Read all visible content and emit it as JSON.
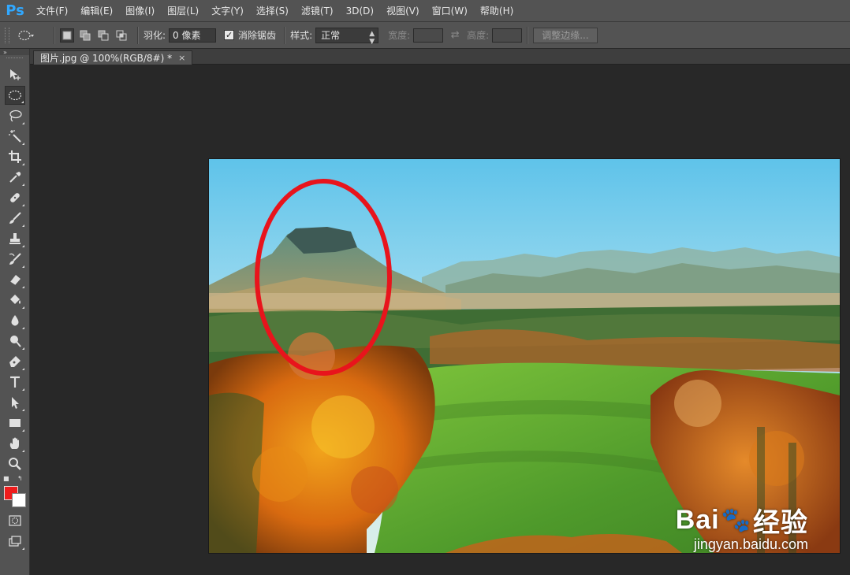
{
  "app": {
    "logo": "Ps"
  },
  "menu": [
    "文件(F)",
    "编辑(E)",
    "图像(I)",
    "图层(L)",
    "文字(Y)",
    "选择(S)",
    "滤镜(T)",
    "3D(D)",
    "视图(V)",
    "窗口(W)",
    "帮助(H)"
  ],
  "options": {
    "feather_label": "羽化:",
    "feather_value": "0 像素",
    "antialias_label": "消除锯齿",
    "antialias_checked": "✓",
    "style_label": "样式:",
    "style_value": "正常",
    "width_label": "宽度:",
    "height_label": "高度:",
    "refine_edge_label": "调整边缘..."
  },
  "document": {
    "tab_title": "图片.jpg @ 100%(RGB/8#) *",
    "close_glyph": "×"
  },
  "watermark": {
    "brand_left": "Bai",
    "brand_right": "经验",
    "paw": "🐾",
    "url": "jingyan.baidu.com"
  },
  "colors": {
    "foreground": "#ef1c1c",
    "background": "#ffffff",
    "annotation": "#e8141c"
  },
  "tools": [
    "move-tool",
    "elliptical-marquee-tool",
    "lasso-tool",
    "magic-wand-tool",
    "crop-tool",
    "eyedropper-tool",
    "healing-brush-tool",
    "brush-tool",
    "clone-stamp-tool",
    "history-brush-tool",
    "eraser-tool",
    "paint-bucket-tool",
    "blur-tool",
    "dodge-tool",
    "pen-tool",
    "type-tool",
    "path-selection-tool",
    "rectangle-tool",
    "hand-tool",
    "zoom-tool"
  ]
}
